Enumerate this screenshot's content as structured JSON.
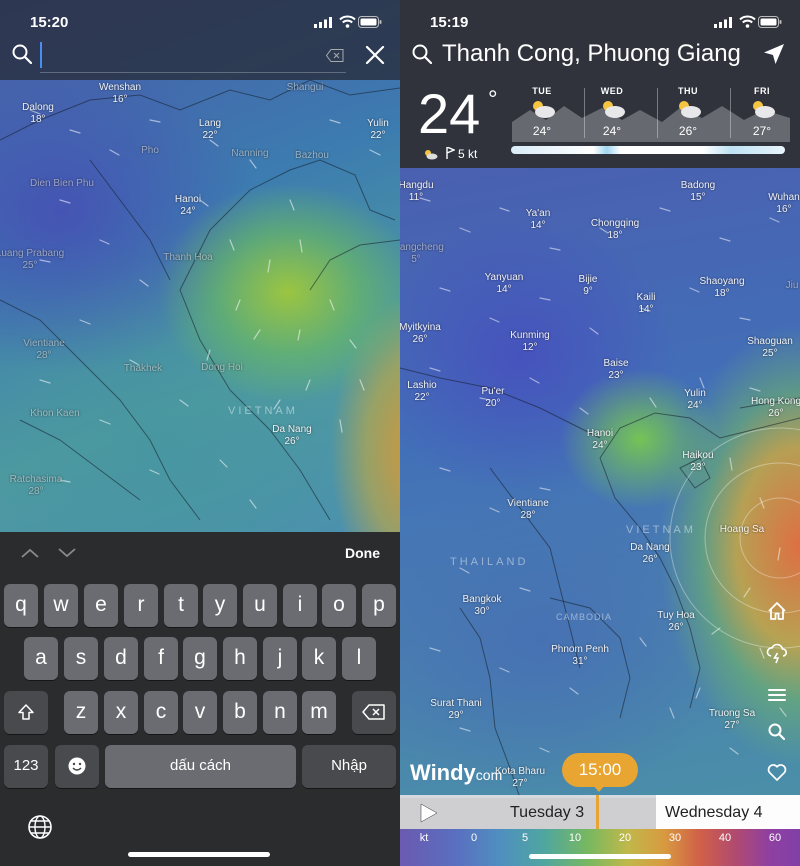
{
  "left": {
    "status": {
      "time": "15:20"
    },
    "search": {
      "value": "",
      "placeholder": ""
    },
    "cities": [
      {
        "name": "Wenshan",
        "val": "16°"
      },
      {
        "name": "Shangui",
        "val": ""
      },
      {
        "name": "Dalong",
        "val": "18°"
      },
      {
        "name": "Lang",
        "val": "22°"
      },
      {
        "name": "Yulin",
        "val": "22°"
      },
      {
        "name": "Pho",
        "val": ""
      },
      {
        "name": "Nanning",
        "val": ""
      },
      {
        "name": "Bazhou",
        "val": ""
      },
      {
        "name": "Dien Bien Phu",
        "val": ""
      },
      {
        "name": "Hanoi",
        "val": "24°"
      },
      {
        "name": "Luang Prabang",
        "val": "25°"
      },
      {
        "name": "Thanh Hoa",
        "val": ""
      },
      {
        "name": "Vientiane",
        "val": "28°"
      },
      {
        "name": "Thakhek",
        "val": ""
      },
      {
        "name": "Dong Hoi",
        "val": ""
      },
      {
        "name": "Khon Kaen",
        "val": ""
      },
      {
        "name": "Da Nang",
        "val": "26°"
      },
      {
        "name": "Ratchasima",
        "val": "28°"
      }
    ],
    "country_label": "VIETNAM",
    "keyboard": {
      "done": "Done",
      "row1": [
        "q",
        "w",
        "e",
        "r",
        "t",
        "y",
        "u",
        "i",
        "o",
        "p"
      ],
      "row2": [
        "a",
        "s",
        "d",
        "f",
        "g",
        "h",
        "j",
        "k",
        "l"
      ],
      "row3": [
        "z",
        "x",
        "c",
        "v",
        "b",
        "n",
        "m"
      ],
      "numbers": "123",
      "space": "dấu cách",
      "return": "Nhập"
    }
  },
  "right": {
    "status": {
      "time": "15:19"
    },
    "location": "Thanh Cong, Phuong Giang",
    "current": {
      "temp": "24",
      "deg": "°",
      "wind": "5 kt"
    },
    "forecast": [
      {
        "day": "TUE",
        "temp": "24°"
      },
      {
        "day": "WED",
        "temp": "24°"
      },
      {
        "day": "THU",
        "temp": "26°"
      },
      {
        "day": "FRI",
        "temp": "27°"
      }
    ],
    "cities": [
      {
        "name": "Badong",
        "val": "15°"
      },
      {
        "name": "Wuhan",
        "val": "16°"
      },
      {
        "name": "Ya'an",
        "val": "14°"
      },
      {
        "name": "Chongqing",
        "val": "18°"
      },
      {
        "name": "Yanyuan",
        "val": "14°"
      },
      {
        "name": "Bijie",
        "val": "9°"
      },
      {
        "name": "Shaoyang",
        "val": "18°"
      },
      {
        "name": "Kaili",
        "val": "14°"
      },
      {
        "name": "Kunming",
        "val": "12°"
      },
      {
        "name": "Shaoguan",
        "val": "25°"
      },
      {
        "name": "Myitkyina",
        "val": "26°"
      },
      {
        "name": "Baise",
        "val": "23°"
      },
      {
        "name": "Lashio",
        "val": "22°"
      },
      {
        "name": "Pu'er",
        "val": "20°"
      },
      {
        "name": "Yulin",
        "val": "24°"
      },
      {
        "name": "Hong Kong",
        "val": "26°"
      },
      {
        "name": "Hanoi",
        "val": "24°"
      },
      {
        "name": "Haikou",
        "val": "23°"
      },
      {
        "name": "Vientiane",
        "val": "28°"
      },
      {
        "name": "Hoang Sa",
        "val": ""
      },
      {
        "name": "Da Nang",
        "val": "26°"
      },
      {
        "name": "Bangkok",
        "val": "30°"
      },
      {
        "name": "Tuy Hoa",
        "val": "26°"
      },
      {
        "name": "Phnom Penh",
        "val": "31°"
      },
      {
        "name": "Surat Thani",
        "val": "29°"
      },
      {
        "name": "Truong Sa",
        "val": "27°"
      },
      {
        "name": "Kota Bharu",
        "val": "27°"
      },
      {
        "name": "Hangdu",
        "val": "11°"
      },
      {
        "name": "Jiu",
        "val": ""
      },
      {
        "name": "Zhangcheng",
        "val": "5°"
      }
    ],
    "country_labels": [
      "THAILAND",
      "VIETNAM",
      "CAMBODIA"
    ],
    "logo": "Windy",
    "logo_suffix": "com",
    "time_bubble": "15:00",
    "timeline": {
      "day1": "Tuesday 3",
      "day2": "Wednesday 4"
    },
    "scale": [
      "kt",
      "0",
      "5",
      "10",
      "20",
      "30",
      "40",
      "60"
    ],
    "sidebar_icons": [
      "home-icon",
      "storm-icon",
      "menu-icon",
      "search-icon",
      "heart-icon"
    ]
  }
}
